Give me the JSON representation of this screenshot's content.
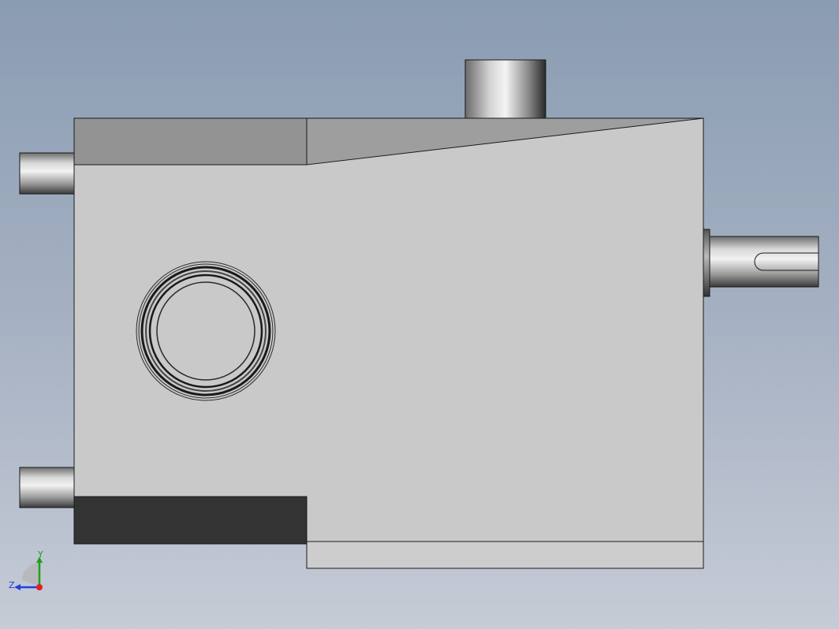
{
  "viewport": {
    "background_top": "#8a9cb2",
    "background_bottom": "#c6cbd6"
  },
  "model": {
    "body_color": "#c9c9c9",
    "top_face_color": "#939393",
    "dark_face_color": "#333333",
    "edge_color": "#1a1a1a"
  },
  "triad": {
    "y_label": "Y",
    "z_label": "Z",
    "x_color": "#e02020",
    "y_color": "#20a020",
    "z_color": "#2040e0"
  }
}
